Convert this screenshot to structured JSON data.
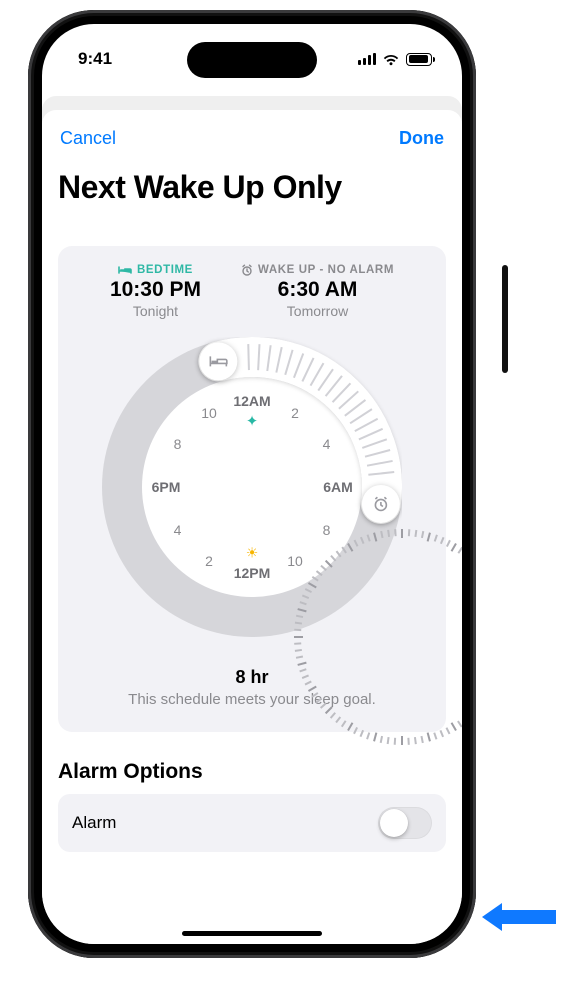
{
  "status": {
    "time": "9:41"
  },
  "nav": {
    "cancel": "Cancel",
    "done": "Done"
  },
  "title": "Next Wake Up Only",
  "bedtime": {
    "label": "BEDTIME",
    "time": "10:30 PM",
    "sub": "Tonight"
  },
  "wakeup": {
    "label": "WAKE UP - NO ALARM",
    "time": "6:30 AM",
    "sub": "Tomorrow"
  },
  "clock": {
    "cardinals": {
      "top": "12AM",
      "right": "6AM",
      "bottom": "12PM",
      "left": "6PM"
    },
    "nums": [
      "2",
      "4",
      "8",
      "10",
      "2",
      "4",
      "8",
      "10"
    ]
  },
  "goal": {
    "hours": "8 hr",
    "sub": "This schedule meets your sleep goal."
  },
  "alarm_options": {
    "heading": "Alarm Options",
    "row_label": "Alarm",
    "enabled": false
  }
}
